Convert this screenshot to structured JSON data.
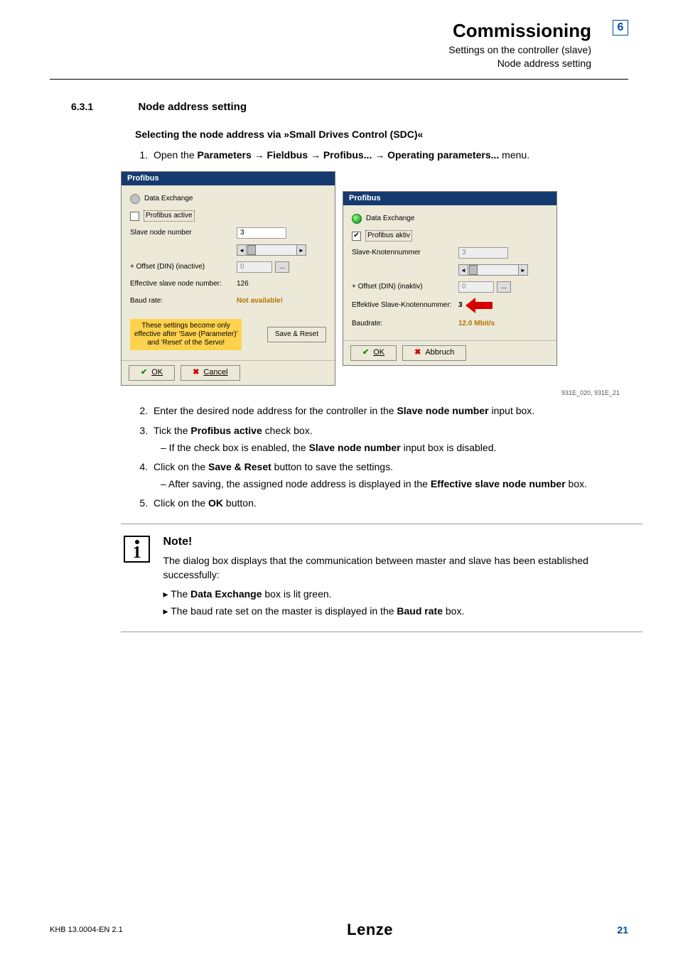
{
  "header": {
    "title": "Commissioning",
    "sub1": "Settings on the controller (slave)",
    "sub2": "Node address setting",
    "chapter": "6"
  },
  "section": {
    "number": "6.3.1",
    "title": "Node address setting",
    "subhead": "Selecting the node address via »Small Drives Control (SDC)«"
  },
  "steps": {
    "s1a": "Open the ",
    "s1b": "Parameters → Fieldbus → Profibus... → Operating parameters...",
    "s1c": " menu.",
    "s2a": "Enter the desired node address for the controller in the ",
    "s2b": "Slave node number",
    "s2c": " input box.",
    "s3a": "Tick the ",
    "s3b": "Profibus active",
    "s3c": " check box.",
    "s3suba": "– If the check box is enabled, the ",
    "s3subb": "Slave node number",
    "s3subc": " input box is disabled.",
    "s4a": "Click on the ",
    "s4b": "Save & Reset",
    "s4c": " button to save the settings.",
    "s4suba": "– After saving, the assigned node address is displayed in the  ",
    "s4subb": "Effective slave node number",
    "s4subc": " box.",
    "s5a": "Click on the ",
    "s5b": "OK",
    "s5c": " button."
  },
  "dlg1": {
    "title": "Profibus",
    "data_exchange": "Data Exchange",
    "profibus_active": "Profibus active",
    "slave_node_number": "Slave node number",
    "slave_node_val": "3",
    "offset_din": "+ Offset (DIN) (inactive)",
    "offset_val": "0",
    "eff_label": "Effective slave node number:",
    "eff_val": "126",
    "baud_label": "Baud rate:",
    "baud_val": "Not available!",
    "note_l1": "These settings become only",
    "note_l2": "effective after 'Save (Parameter)'",
    "note_l3": "and 'Reset' of the Servo!",
    "save_btn": "Save & Reset",
    "ok": "OK",
    "cancel": "Cancel"
  },
  "dlg2": {
    "title": "Profibus",
    "data_exchange": "Data Exchange",
    "profibus_aktiv": "Profibus aktiv",
    "slave_knot": "Slave-Knotennummer",
    "slave_knot_val": "3",
    "offset_din": "+ Offset (DIN) (inaktiv)",
    "offset_val": "0",
    "eff_label": "Effektive Slave-Knotennummer:",
    "eff_val": "3",
    "baud_label": "Baudrate:",
    "baud_val": "12.0 Mbit/s",
    "ok": "OK",
    "cancel": "Abbruch"
  },
  "caption": "931E_020,  931E_21",
  "note": {
    "title": "Note!",
    "text": "The dialog box displays that the communication between master and slave has been established successfully:",
    "li1a": "The ",
    "li1b": "Data Exchange",
    "li1c": " box is lit green.",
    "li2a": "The baud rate set on the master is displayed in the ",
    "li2b": "Baud rate",
    "li2c": " box."
  },
  "footer": {
    "left": "KHB 13.0004-EN    2.1",
    "logo": "Lenze",
    "page": "21"
  }
}
